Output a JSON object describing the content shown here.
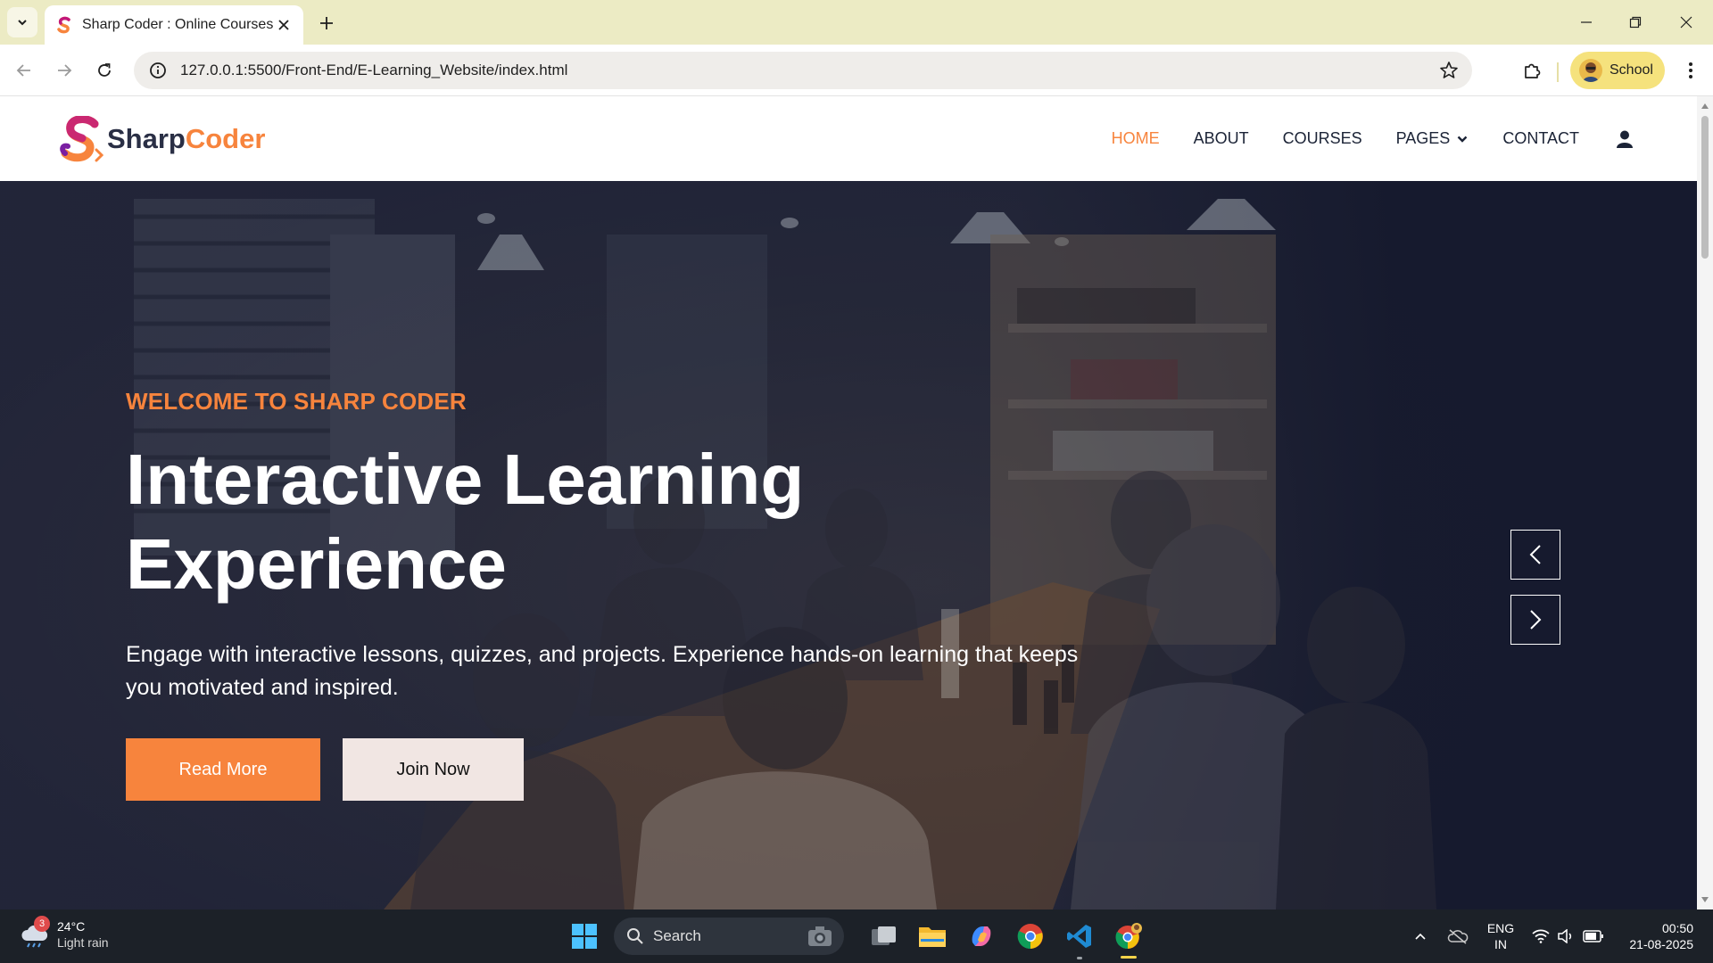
{
  "browser": {
    "tab_title": "Sharp Coder : Online Courses",
    "url": "127.0.0.1:5500/Front-End/E-Learning_Website/index.html",
    "profile_name": "School"
  },
  "site": {
    "logo_part1": "Sharp",
    "logo_part2": "Coder",
    "nav": {
      "home": "HOME",
      "about": "ABOUT",
      "courses": "COURSES",
      "pages": "PAGES",
      "contact": "CONTACT"
    }
  },
  "hero": {
    "kicker": "WELCOME TO SHARP CODER",
    "title": "Interactive Learning Experience",
    "description": "Engage with interactive lessons, quizzes, and projects. Experience hands-on learning that keeps you motivated and inspired.",
    "primary_button": "Read More",
    "secondary_button": "Join Now"
  },
  "taskbar": {
    "weather_badge": "3",
    "weather_temp": "24°C",
    "weather_desc": "Light rain",
    "search_placeholder": "Search",
    "lang_line1": "ENG",
    "lang_line2": "IN",
    "time": "00:50",
    "date": "21-08-2025"
  },
  "colors": {
    "accent": "#f7843d",
    "tabstrip": "#ecebc4",
    "hero_overlay": "#1e2236",
    "taskbar": "#1c2128"
  }
}
